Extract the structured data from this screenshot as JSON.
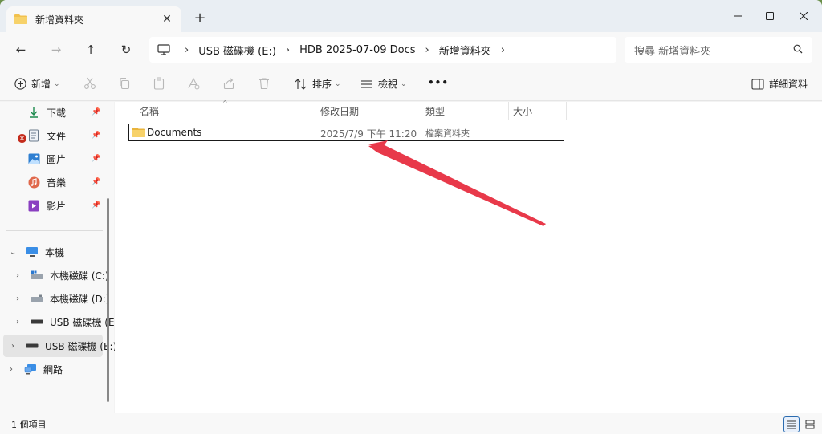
{
  "window": {
    "tab_title": "新增資料夾",
    "new_tab": "+",
    "close_tab": "✕",
    "minimize": "—",
    "maximize": "☐",
    "close": "✕"
  },
  "nav": {
    "back": "←",
    "forward": "→",
    "up": "↑",
    "refresh": "↻",
    "breadcrumbs": [
      "USB 磁碟機 (E:)",
      "HDB 2025-07-09 Docs",
      "新增資料夾"
    ],
    "search_placeholder": "搜尋 新增資料夾"
  },
  "commands": {
    "new": "新增",
    "sort": "排序",
    "view": "檢視",
    "more": "•••",
    "details": "詳細資料"
  },
  "sidebar": {
    "quick": [
      {
        "label": "下載",
        "icon": "download-icon"
      },
      {
        "label": "文件",
        "icon": "document-icon"
      },
      {
        "label": "圖片",
        "icon": "pictures-icon"
      },
      {
        "label": "音樂",
        "icon": "music-icon"
      },
      {
        "label": "影片",
        "icon": "video-icon"
      }
    ],
    "this_pc": "本機",
    "drives": [
      {
        "label": "本機磁碟 (C:)"
      },
      {
        "label": "本機磁碟 (D:)"
      },
      {
        "label": "USB 磁碟機 (E"
      },
      {
        "label": "USB 磁碟機 (E:)"
      }
    ],
    "network": "網路"
  },
  "columns": {
    "name": "名稱",
    "modified": "修改日期",
    "type": "類型",
    "size": "大小"
  },
  "files": [
    {
      "name": "Documents",
      "modified": "2025/7/9 下午 11:20",
      "type": "檔案資料夾",
      "size": ""
    }
  ],
  "status": {
    "item_count": "1 個項目"
  },
  "colors": {
    "annotation_arrow": "#e8394a",
    "folder_yellow": "#f2c14e",
    "accent_blue": "#2b6cb0"
  }
}
